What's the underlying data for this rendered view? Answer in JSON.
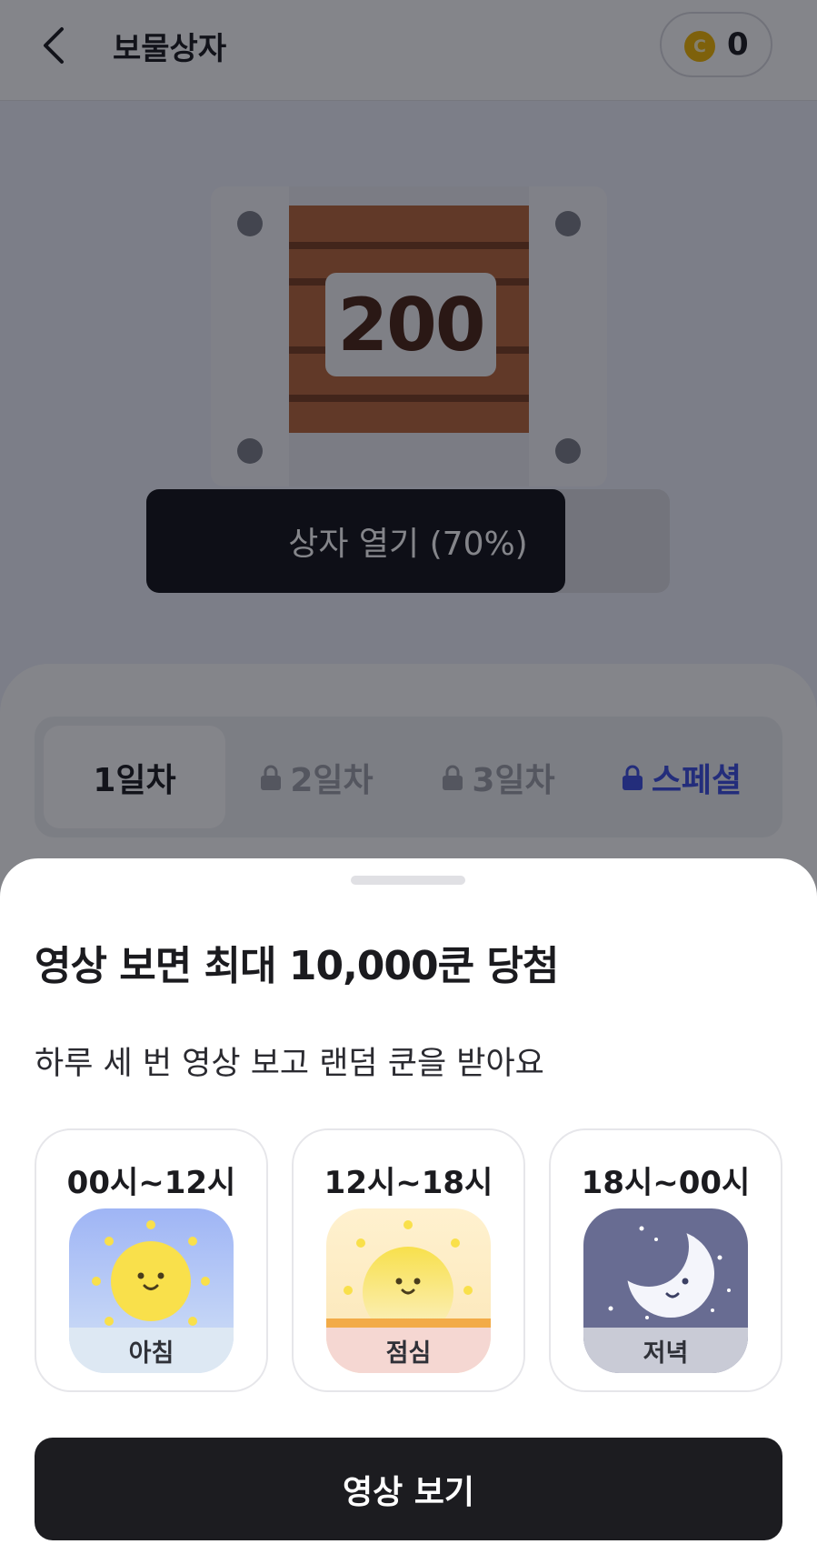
{
  "header": {
    "title": "보물상자",
    "coin_symbol": "C",
    "coin_count": "0"
  },
  "chest": {
    "amount": "200",
    "open_label": "상자 열기 (70%)",
    "open_progress": 0.8
  },
  "tabs": [
    {
      "label": "1일차",
      "locked": false,
      "active": true
    },
    {
      "label": "2일차",
      "locked": true,
      "active": false
    },
    {
      "label": "3일차",
      "locked": true,
      "active": false
    },
    {
      "label": "스페셜",
      "locked": true,
      "active": false
    }
  ],
  "sheet": {
    "title": "영상 보면 최대 10,000쿤 당첨",
    "subtitle": "하루 세 번 영상 보고 랜덤 쿤을 받아요",
    "slots": [
      {
        "time": "00시~12시",
        "label": "아침",
        "icon": "morning-sun-icon"
      },
      {
        "time": "12시~18시",
        "label": "점심",
        "icon": "afternoon-sunset-icon"
      },
      {
        "time": "18시~00시",
        "label": "저녁",
        "icon": "night-moon-icon"
      }
    ],
    "button_label": "영상 보기"
  },
  "colors": {
    "accent_dark": "#1c1c20",
    "special_tab": "#3d4ee0",
    "coin": "#f2b600",
    "chest_wood": "#b8663a"
  }
}
